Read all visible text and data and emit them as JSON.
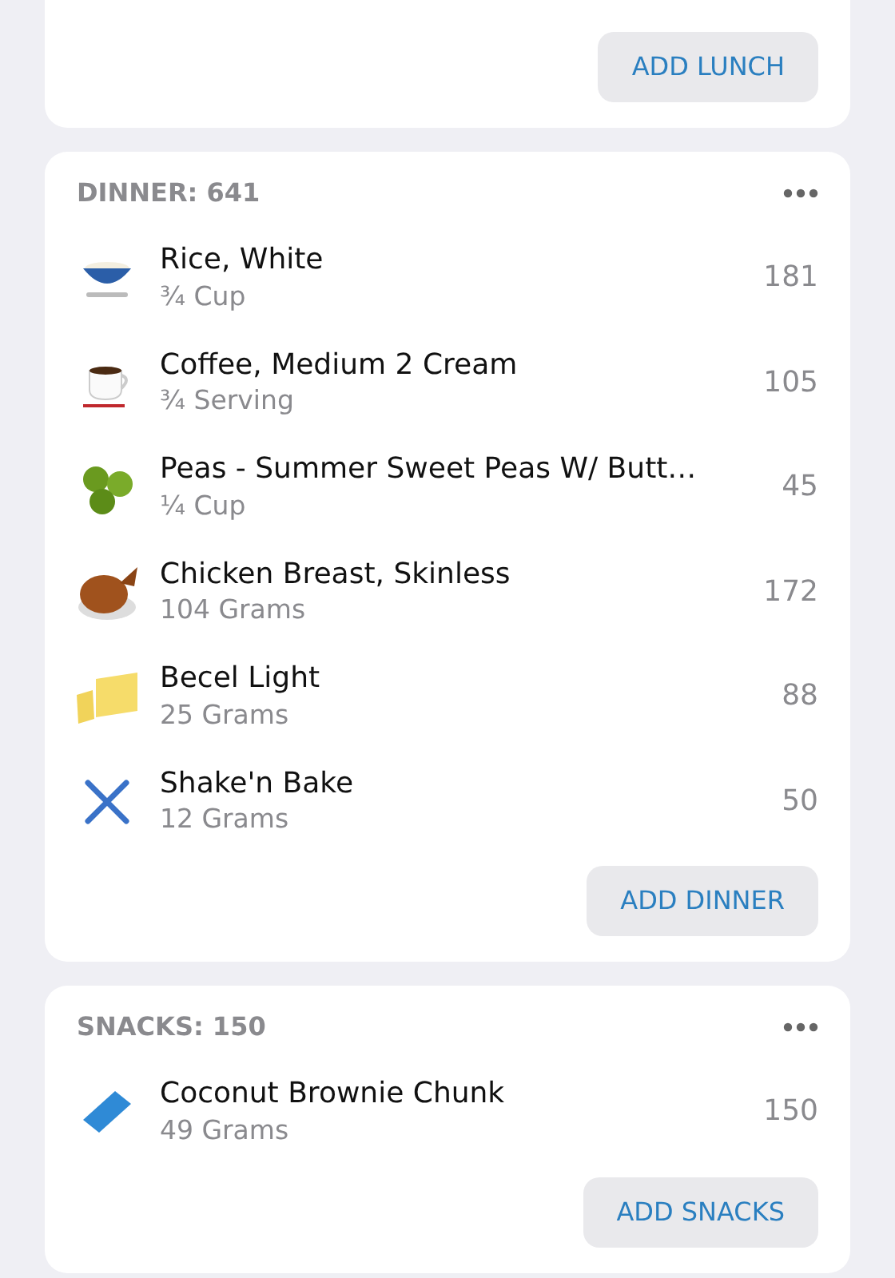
{
  "meals": [
    {
      "button": "ADD LUNCH"
    },
    {
      "title": "DINNER: 641",
      "items": [
        {
          "kind": "rice",
          "name": "Rice, White",
          "amount": "¾ Cup",
          "calories": "181"
        },
        {
          "kind": "coffee",
          "name": "Coffee, Medium 2 Cream",
          "amount": "¾ Serving",
          "calories": "105"
        },
        {
          "kind": "peas",
          "name": "Peas - Summer Sweet Peas W/ Butt…",
          "amount": "¼ Cup",
          "calories": "45"
        },
        {
          "kind": "chicken",
          "name": "Chicken Breast, Skinless",
          "amount": "104 Grams",
          "calories": "172"
        },
        {
          "kind": "butter",
          "name": "Becel Light",
          "amount": "25 Grams",
          "calories": "88"
        },
        {
          "kind": "utensils",
          "name": "Shake'n Bake",
          "amount": "12 Grams",
          "calories": "50"
        }
      ],
      "button": "ADD DINNER"
    },
    {
      "title": "SNACKS: 150",
      "items": [
        {
          "kind": "bar",
          "name": "Coconut Brownie Chunk",
          "amount": "49 Grams",
          "calories": "150"
        }
      ],
      "button": "ADD SNACKS"
    }
  ]
}
